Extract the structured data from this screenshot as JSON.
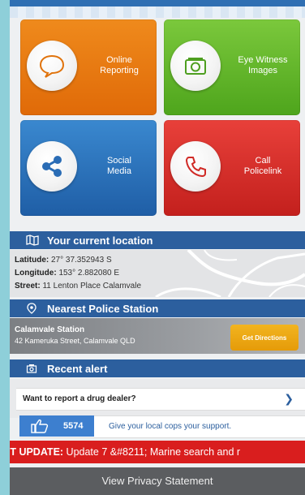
{
  "tiles": [
    {
      "label_line1": "Online",
      "label_line2": "Reporting",
      "icon": "speech-bubble-icon",
      "color": "#e87a12"
    },
    {
      "label_line1": "Eye Witness",
      "label_line2": "Images",
      "icon": "camera-icon",
      "color": "#5fb22a"
    },
    {
      "label_line1": "Social",
      "label_line2": "Media",
      "icon": "share-icon",
      "color": "#2e72bb"
    },
    {
      "label_line1": "Call",
      "label_line2": "Policelink",
      "icon": "phone-icon",
      "color": "#d6302b"
    }
  ],
  "location": {
    "title": "Your current location",
    "latitude_label": "Latitude:",
    "latitude_value": "27° 37.352943 S",
    "longitude_label": "Longitude:",
    "longitude_value": "153° 2.882080 E",
    "street_label": "Street:",
    "street_value": "11 Lenton Place Calamvale"
  },
  "station": {
    "title": "Nearest Police Station",
    "name": "Calamvale Station",
    "address": "42 Kameruka Street, Calamvale QLD",
    "directions_label": "Get Directions"
  },
  "alert": {
    "title": "Recent alert",
    "drug_prompt": "Want to report a drug dealer?",
    "like_count": "5574",
    "support_text": "Give your local cops your support."
  },
  "ticker": {
    "prefix": "ST UPDATE:",
    "text": " Update 7 &#8211; Marine search and r"
  },
  "footer": {
    "privacy_label": "View Privacy Statement"
  },
  "colors": {
    "header_blue": "#2c5f9e",
    "ticker_red": "#d91e1e",
    "directions_orange": "#eea814"
  }
}
